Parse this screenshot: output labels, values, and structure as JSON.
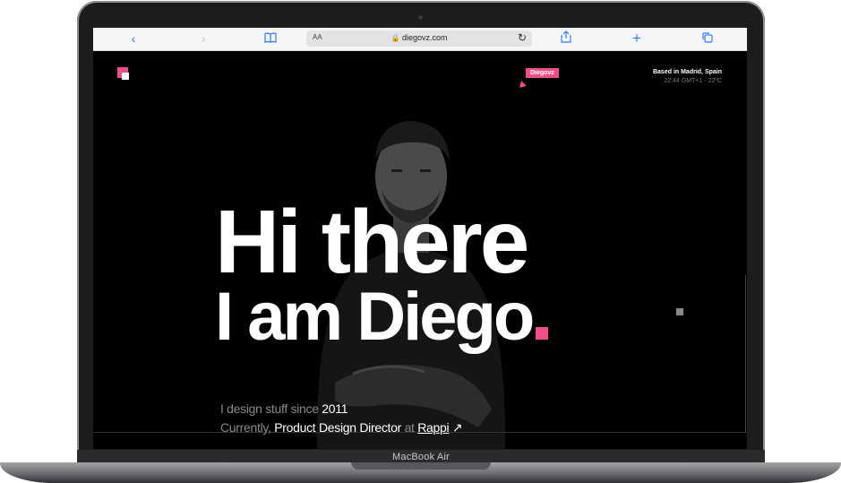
{
  "browser": {
    "url": "diegovz.com",
    "text_size_label": "AA"
  },
  "site": {
    "badge": "Diegovz",
    "location": "Based in Madrid, Spain",
    "time_info": "22:44 GMT+1 · 22ºC",
    "headline_line1": "Hi there",
    "headline_line2": "I am Diego",
    "intro_prefix": "I design stuff since",
    "intro_year": "2011",
    "currently_prefix": "Currently,",
    "role": "Product Design Director",
    "at": "at",
    "company": "Rappi",
    "company_arrow": "↗"
  },
  "device": {
    "model": "MacBook Air"
  },
  "colors": {
    "accent": "#ee4f8a",
    "browser_blue": "#2f7bf5",
    "background": "#000000"
  },
  "icons": [
    "back-icon",
    "forward-icon",
    "bookmarks-icon",
    "lock-icon",
    "reload-icon",
    "share-icon",
    "new-tab-icon",
    "tabs-icon"
  ]
}
